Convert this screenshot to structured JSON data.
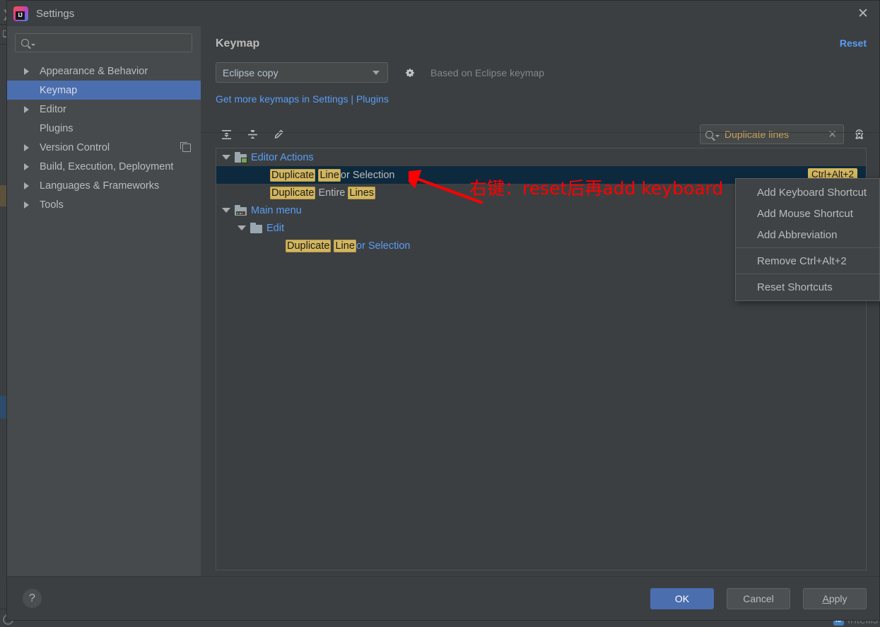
{
  "background": {
    "watermark": "IntelliJ",
    "chevron_icon": "chevron-right-icon",
    "puzzle_icon": "puzzle-icon"
  },
  "dialog": {
    "title": "Settings",
    "logo_icon": "intellij-idea-logo-icon",
    "close_icon": "close-icon"
  },
  "sidebar": {
    "search": {
      "value": "",
      "placeholder": "",
      "icon": "search-icon"
    },
    "items": [
      {
        "label": "Appearance & Behavior",
        "expandable": true,
        "selected": false
      },
      {
        "label": "Keymap",
        "expandable": false,
        "selected": true
      },
      {
        "label": "Editor",
        "expandable": true,
        "selected": false
      },
      {
        "label": "Plugins",
        "expandable": false,
        "selected": false
      },
      {
        "label": "Version Control",
        "expandable": true,
        "selected": false,
        "trailing_icon": "copy-icon"
      },
      {
        "label": "Build, Execution, Deployment",
        "expandable": true,
        "selected": false
      },
      {
        "label": "Languages & Frameworks",
        "expandable": true,
        "selected": false
      },
      {
        "label": "Tools",
        "expandable": true,
        "selected": false
      }
    ]
  },
  "main": {
    "title": "Keymap",
    "reset_label": "Reset",
    "keymap_selected": "Eclipse copy",
    "gear_icon": "gear-icon",
    "based_on": "Based on Eclipse keymap",
    "more_keymaps_link": "Get more keymaps in Settings | Plugins",
    "toolbar": {
      "expand_all_icon": "expand-all-icon",
      "collapse_all_icon": "collapse-all-icon",
      "edit_icon": "pencil-edit-icon",
      "filter_value": "Duplicate lines",
      "filter_clear_icon": "clear-icon",
      "find_shortcut_icon": "find-by-shortcut-icon"
    },
    "tree": [
      {
        "depth": 0,
        "type": "group",
        "expanded": true,
        "icon": "editor-actions-folder-icon",
        "label": "Editor Actions",
        "style": "link",
        "selected": false,
        "parts": [],
        "shortcut": ""
      },
      {
        "depth": 2,
        "type": "action",
        "expanded": null,
        "icon": "",
        "label": "Duplicate Line or Selection",
        "style": "plain",
        "selected": true,
        "parts": [
          {
            "text": "Duplicate",
            "hl": true
          },
          {
            "text": " ",
            "hl": false
          },
          {
            "text": "Line",
            "hl": true
          },
          {
            "text": " or Selection",
            "hl": false
          }
        ],
        "shortcut": "Ctrl+Alt+2"
      },
      {
        "depth": 2,
        "type": "action",
        "expanded": null,
        "icon": "",
        "label": "Duplicate Entire Lines",
        "style": "plain",
        "selected": false,
        "parts": [
          {
            "text": "Duplicate",
            "hl": true
          },
          {
            "text": " Entire ",
            "hl": false
          },
          {
            "text": "Lines",
            "hl": true
          }
        ],
        "shortcut": ""
      },
      {
        "depth": 0,
        "type": "group",
        "expanded": true,
        "icon": "main-menu-folder-icon",
        "label": "Main menu",
        "style": "link",
        "selected": false,
        "parts": [],
        "shortcut": ""
      },
      {
        "depth": 1,
        "type": "group",
        "expanded": true,
        "icon": "folder-icon",
        "label": "Edit",
        "style": "link",
        "selected": false,
        "parts": [],
        "shortcut": ""
      },
      {
        "depth": 3,
        "type": "action",
        "expanded": null,
        "icon": "",
        "label": "Duplicate Line or Selection",
        "style": "link",
        "selected": false,
        "parts": [
          {
            "text": "Duplicate",
            "hl": true
          },
          {
            "text": " ",
            "hl": false
          },
          {
            "text": "Line",
            "hl": true
          },
          {
            "text": " or Selection",
            "hl": false
          }
        ],
        "shortcut": ""
      }
    ]
  },
  "annotation": {
    "text": "右键：reset后再add keyboard",
    "color": "#fe0000",
    "arrow_icon": "red-arrow-icon"
  },
  "context_menu": {
    "items": [
      {
        "label": "Add Keyboard Shortcut",
        "separator_after": false
      },
      {
        "label": "Add Mouse Shortcut",
        "separator_after": false
      },
      {
        "label": "Add Abbreviation",
        "separator_after": true
      },
      {
        "label": "Remove Ctrl+Alt+2",
        "separator_after": true
      },
      {
        "label": "Reset Shortcuts",
        "separator_after": false
      }
    ]
  },
  "footer": {
    "help_icon": "help-icon",
    "ok_label": "OK",
    "cancel_label": "Cancel",
    "apply_label": "Apply",
    "apply_mnemonic": "A"
  },
  "colors": {
    "accent": "#4b6eaf",
    "link": "#589df6",
    "highlight": "#d3b65e",
    "selection_row": "#0d293e",
    "annotation": "#fe0000"
  }
}
